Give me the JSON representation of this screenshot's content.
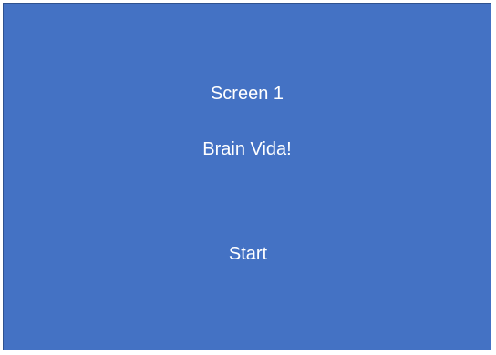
{
  "screen": {
    "heading": "Screen 1",
    "app_name": "Brain Vida!",
    "start_label": "Start",
    "background_color": "#4472c4",
    "border_color": "#2f528f",
    "text_color": "#ffffff"
  }
}
